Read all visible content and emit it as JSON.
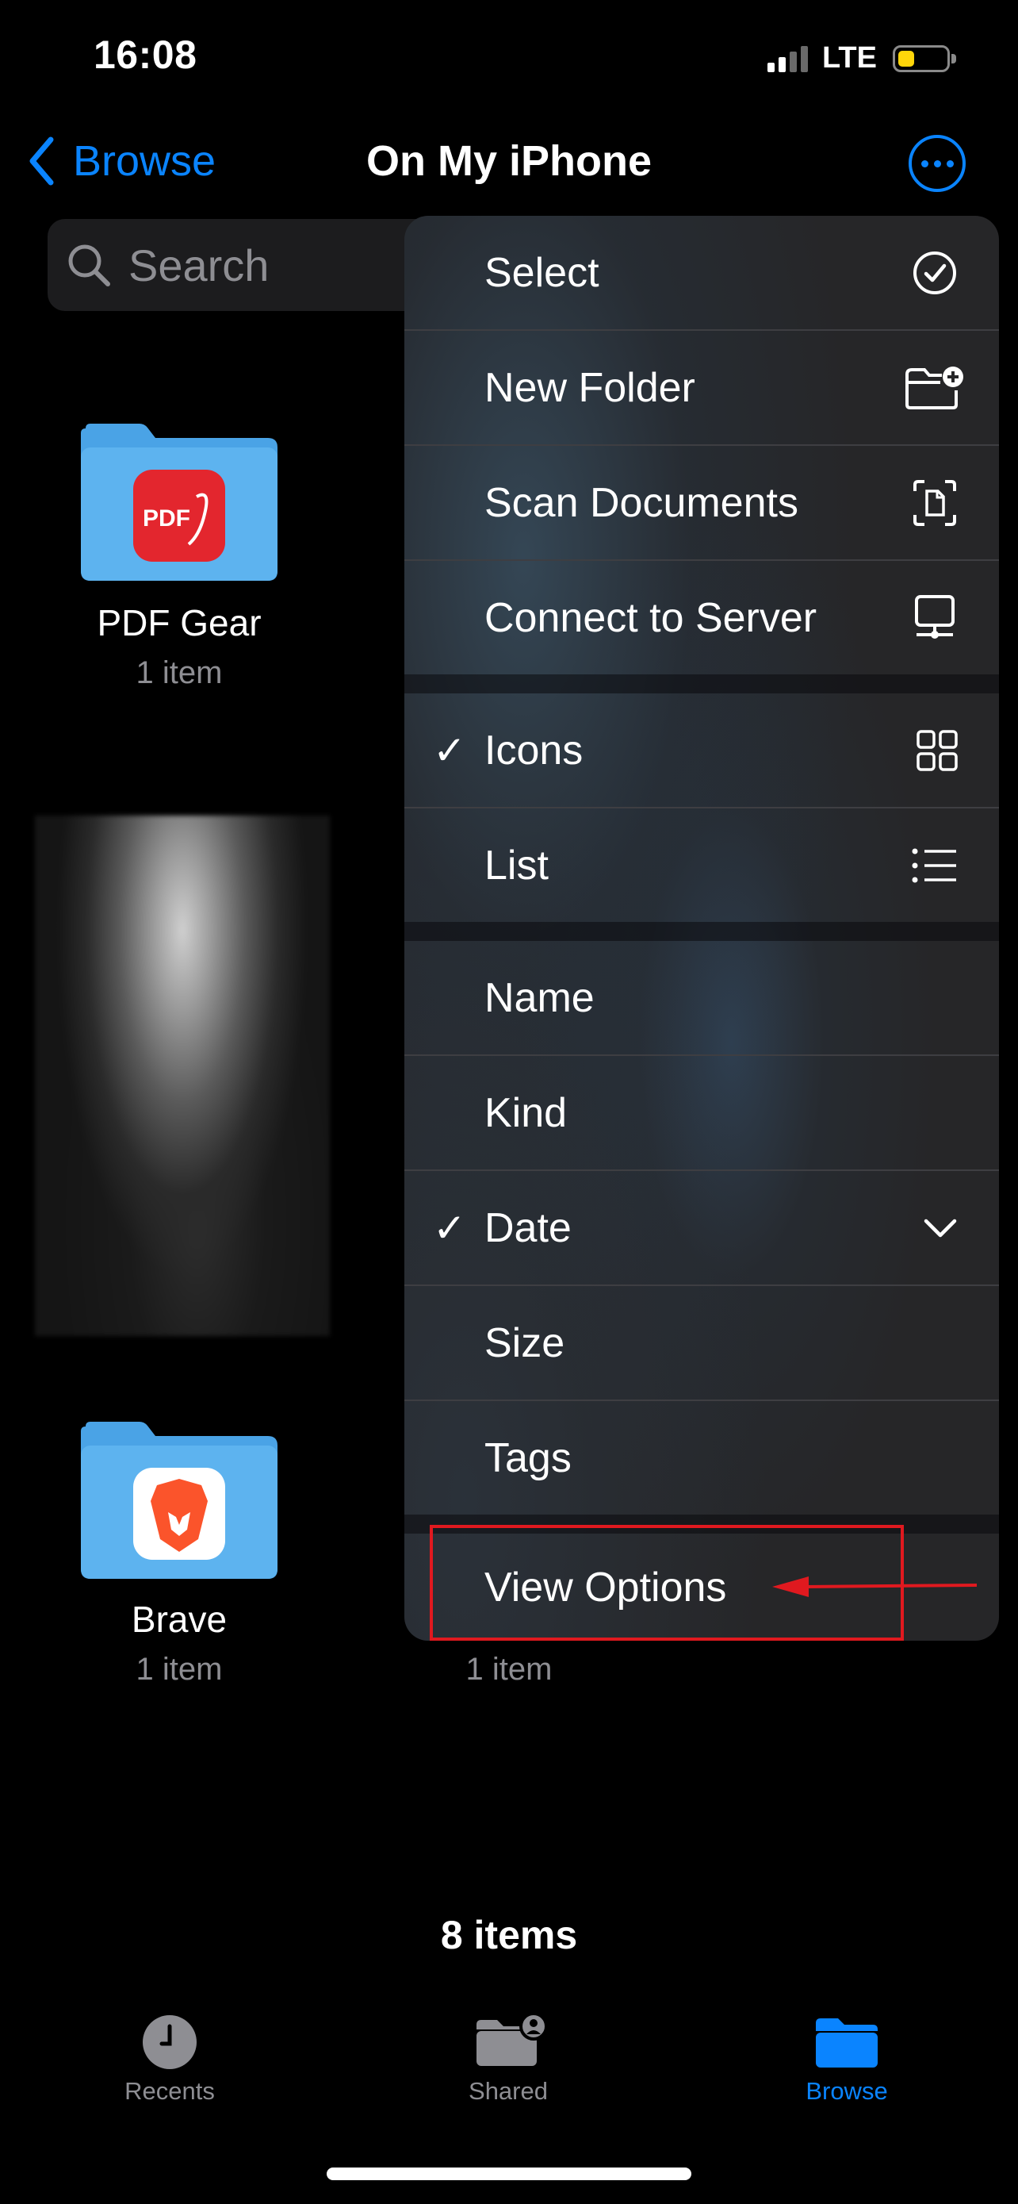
{
  "status_bar": {
    "time": "16:08",
    "network": "LTE",
    "battery_level": 0.35,
    "battery_color": "#ffd60a"
  },
  "nav": {
    "back_label": "Browse",
    "title": "On My iPhone",
    "more_icon": "ellipsis-circle-icon"
  },
  "search": {
    "placeholder": "Search"
  },
  "files": [
    {
      "name": "PDF Gear",
      "count": "1 item",
      "icon": "pdf-gear-app-icon"
    },
    {
      "name": "Brave",
      "count": "1 item",
      "icon": "brave-app-icon"
    },
    {
      "name": "",
      "count": "1 item"
    }
  ],
  "menu": {
    "items": [
      {
        "label": "Select",
        "icon": "checkmark-circle-icon",
        "checked": false
      },
      {
        "label": "New Folder",
        "icon": "folder-badge-plus-icon",
        "checked": false
      },
      {
        "label": "Scan Documents",
        "icon": "doc-viewfinder-icon",
        "checked": false
      },
      {
        "label": "Connect to Server",
        "icon": "server-display-icon",
        "checked": false
      },
      {
        "label": "Icons",
        "icon": "grid-icon",
        "checked": true
      },
      {
        "label": "List",
        "icon": "list-bullet-icon",
        "checked": false
      },
      {
        "label": "Name",
        "checked": false
      },
      {
        "label": "Kind",
        "checked": false
      },
      {
        "label": "Date",
        "icon": "chevron-down-icon",
        "checked": true
      },
      {
        "label": "Size",
        "checked": false
      },
      {
        "label": "Tags",
        "checked": false
      },
      {
        "label": "View Options",
        "checked": false
      }
    ],
    "check_glyph": "✓"
  },
  "annotation": {
    "color": "#e0191f",
    "target": "View Options"
  },
  "footer": {
    "items_count": "8 items"
  },
  "tabs": [
    {
      "label": "Recents",
      "icon": "clock-icon",
      "active": false
    },
    {
      "label": "Shared",
      "icon": "shared-folder-icon",
      "active": false
    },
    {
      "label": "Browse",
      "icon": "folder-icon",
      "active": true
    }
  ],
  "colors": {
    "accent": "#0a84ff",
    "background": "#000000",
    "menu_bg": "#262628"
  }
}
